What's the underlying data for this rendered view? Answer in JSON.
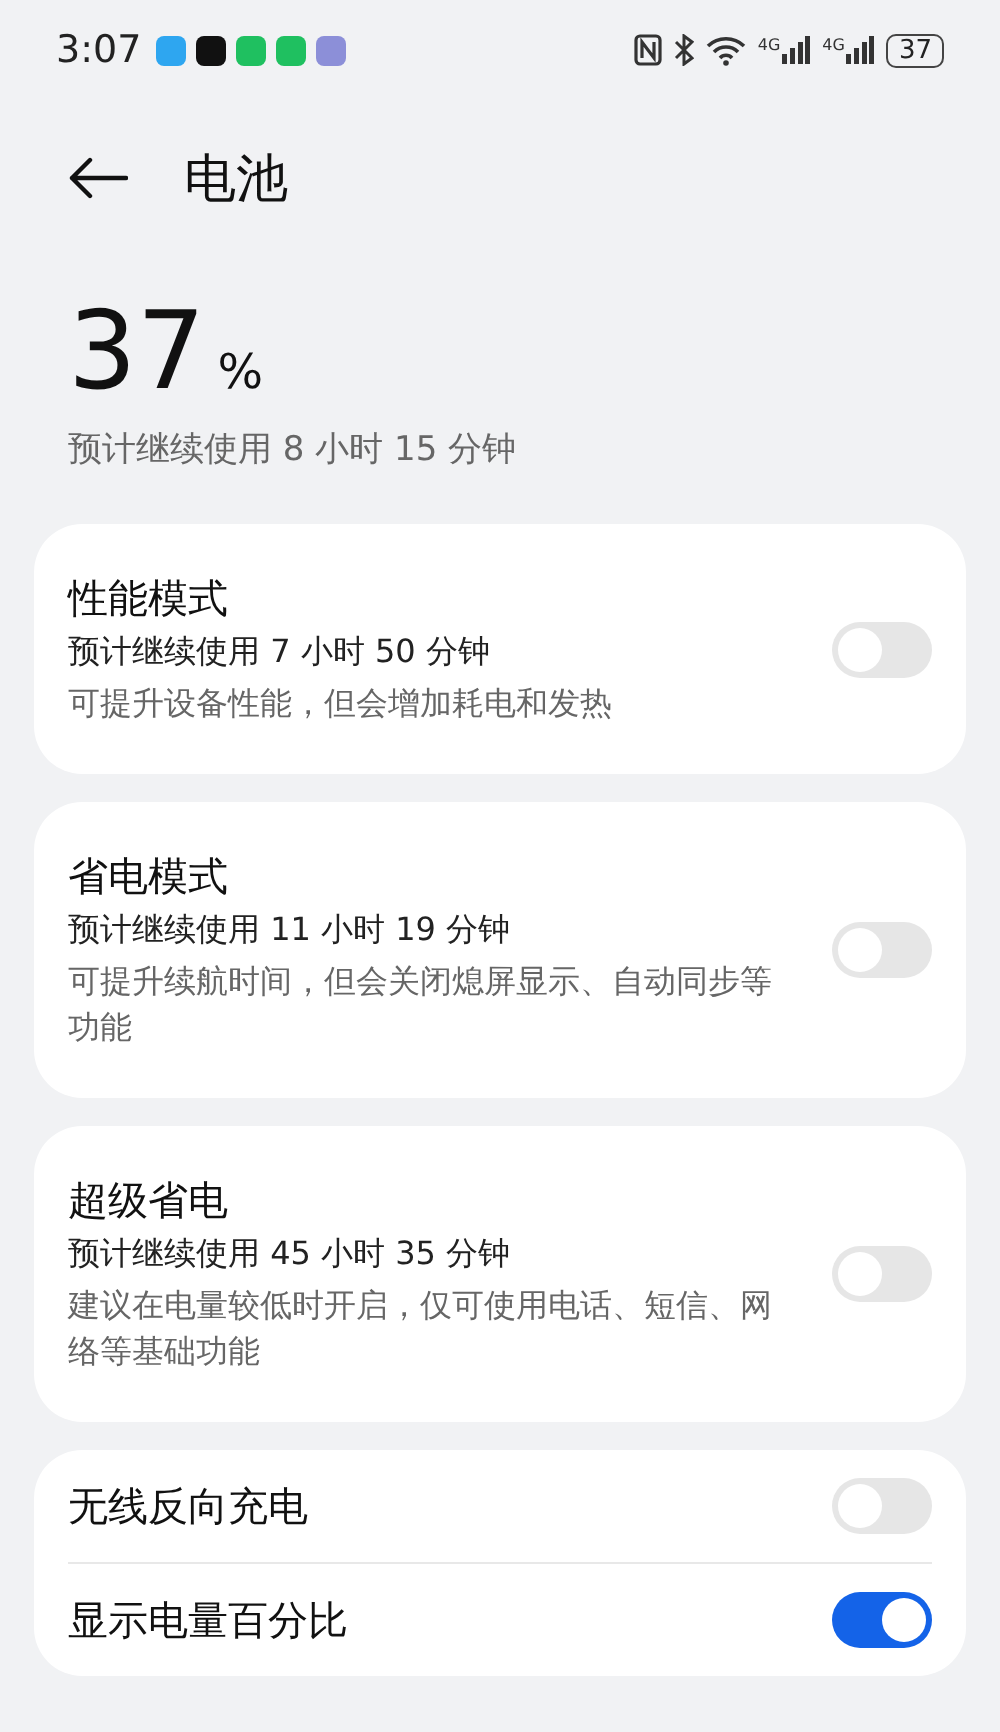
{
  "status_bar": {
    "time": "3:07",
    "apps": [
      {
        "color": "#2ea6f0"
      },
      {
        "color": "#111111"
      },
      {
        "color": "#1fc060"
      },
      {
        "color": "#1fc060"
      },
      {
        "color": "#8c8fd8"
      }
    ],
    "network": [
      "4G",
      "4G"
    ],
    "battery": "37"
  },
  "header": {
    "title": "电池"
  },
  "summary": {
    "percent": "37",
    "unit": "%",
    "estimate": "预计继续使用 8 小时 15 分钟"
  },
  "modes": [
    {
      "title": "性能模式",
      "estimate": "预计继续使用 7 小时 50 分钟",
      "description": "可提升设备性能，但会增加耗电和发热",
      "on": false
    },
    {
      "title": "省电模式",
      "estimate": "预计继续使用 11 小时 19 分钟",
      "description": "可提升续航时间，但会关闭熄屏显示、自动同步等功能",
      "on": false
    },
    {
      "title": "超级省电",
      "estimate": "预计继续使用 45 小时 35 分钟",
      "description": "建议在电量较低时开启，仅可使用电话、短信、网络等基础功能",
      "on": false
    }
  ],
  "settings": [
    {
      "title": "无线反向充电",
      "on": false
    },
    {
      "title": "显示电量百分比",
      "on": true
    }
  ]
}
